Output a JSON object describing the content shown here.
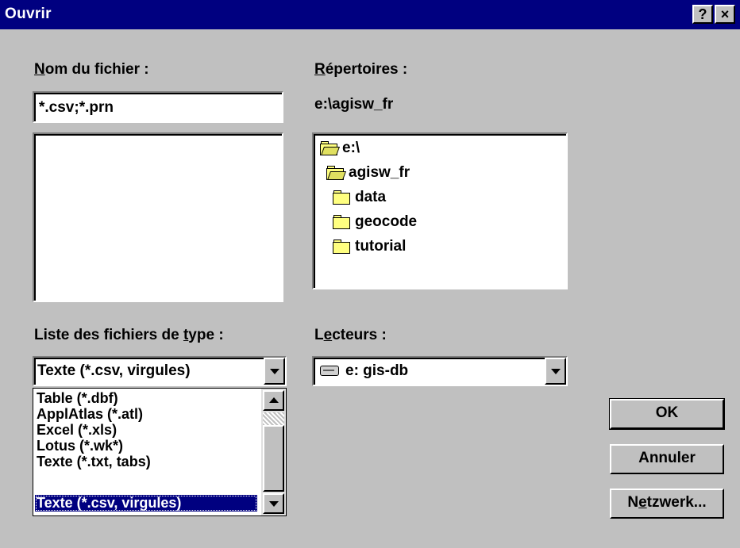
{
  "window": {
    "title": "Ouvrir",
    "help_glyph": "?",
    "close_glyph": "×"
  },
  "filename": {
    "label_u": "N",
    "label_rest": "om du fichier :",
    "value": "*.csv;*.prn"
  },
  "directories": {
    "label_u": "R",
    "label_rest": "épertoires :",
    "current_path": "e:\\agisw_fr",
    "tree": [
      {
        "name": "e:\\",
        "icon": "folder-open-icon",
        "indent": 0
      },
      {
        "name": "agisw_fr",
        "icon": "folder-open-icon",
        "indent": 1
      },
      {
        "name": "data",
        "icon": "folder-icon",
        "indent": 1
      },
      {
        "name": "geocode",
        "icon": "folder-icon",
        "indent": 1
      },
      {
        "name": "tutorial",
        "icon": "folder-icon",
        "indent": 1
      }
    ]
  },
  "file_type": {
    "label_pre": "Liste des fichiers de ",
    "label_u": "t",
    "label_post": "ype :",
    "selected": "Texte (*.csv, virgules)",
    "options": [
      "Table (*.dbf)",
      "ApplAtlas (*.atl)",
      "Excel (*.xls)",
      "Lotus (*.wk*)",
      "Texte (*.txt, tabs)",
      "Texte (*.csv, virgules)"
    ]
  },
  "drives": {
    "label_pre": "L",
    "label_u": "e",
    "label_post": "cteurs :",
    "selected": "e: gis-db",
    "icon": "drive-icon"
  },
  "buttons": {
    "ok": "OK",
    "cancel": "Annuler",
    "network_pre": "N",
    "network_u": "e",
    "network_post": "tzwerk..."
  },
  "colors": {
    "face": "#c0c0c0",
    "titlebar": "#000080",
    "selection": "#000080",
    "folder": "#ffff80"
  }
}
